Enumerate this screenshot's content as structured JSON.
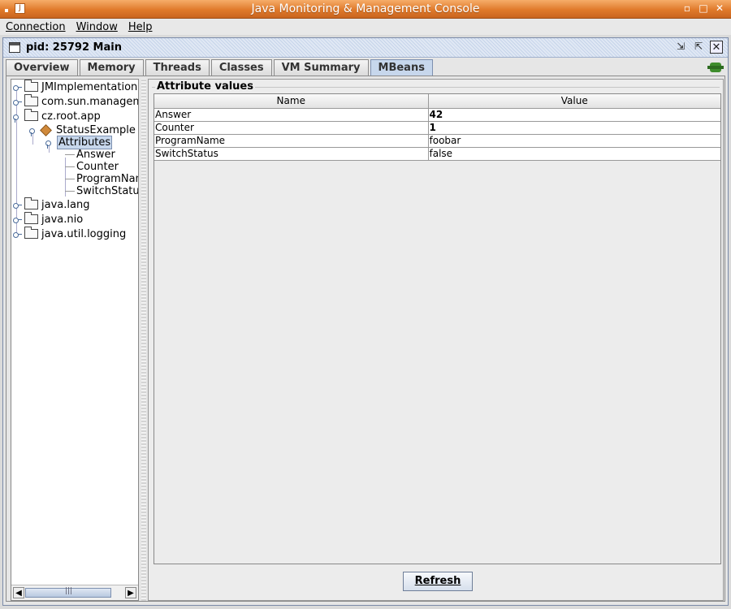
{
  "window": {
    "title": "Java Monitoring & Management Console",
    "app_icon": "java-icon",
    "controls": [
      "minimize",
      "maximize",
      "close"
    ]
  },
  "menubar": [
    {
      "label": "Connection"
    },
    {
      "label": "Window"
    },
    {
      "label": "Help"
    }
  ],
  "frame": {
    "title": "pid: 25792 Main",
    "controls": [
      "restore",
      "maximize",
      "close"
    ]
  },
  "tabs": [
    {
      "label": "Overview",
      "active": false
    },
    {
      "label": "Memory",
      "active": false
    },
    {
      "label": "Threads",
      "active": false
    },
    {
      "label": "Classes",
      "active": false
    },
    {
      "label": "VM Summary",
      "active": false
    },
    {
      "label": "MBeans",
      "active": true
    }
  ],
  "tree": [
    {
      "label": "JMImplementation",
      "type": "folder",
      "expanded": false
    },
    {
      "label": "com.sun.managem",
      "type": "folder",
      "expanded": false
    },
    {
      "label": "cz.root.app",
      "type": "folder",
      "expanded": true
    },
    {
      "label": "StatusExample",
      "type": "bean",
      "expanded": true
    },
    {
      "label": "Attributes",
      "type": "group",
      "expanded": true,
      "selected": true
    },
    {
      "label": "Answer",
      "type": "leaf"
    },
    {
      "label": "Counter",
      "type": "leaf"
    },
    {
      "label": "ProgramNam",
      "type": "leaf"
    },
    {
      "label": "SwitchStatus",
      "type": "leaf"
    },
    {
      "label": "java.lang",
      "type": "folder",
      "expanded": false
    },
    {
      "label": "java.nio",
      "type": "folder",
      "expanded": false
    },
    {
      "label": "java.util.logging",
      "type": "folder",
      "expanded": false
    }
  ],
  "attributes": {
    "panel_title": "Attribute values",
    "columns": [
      "Name",
      "Value"
    ],
    "rows": [
      {
        "name": "Answer",
        "value": "42",
        "bold": true
      },
      {
        "name": "Counter",
        "value": "1",
        "bold": true
      },
      {
        "name": "ProgramName",
        "value": "foobar",
        "bold": false
      },
      {
        "name": "SwitchStatus",
        "value": "false",
        "bold": false
      }
    ]
  },
  "refresh_label": "Refresh"
}
